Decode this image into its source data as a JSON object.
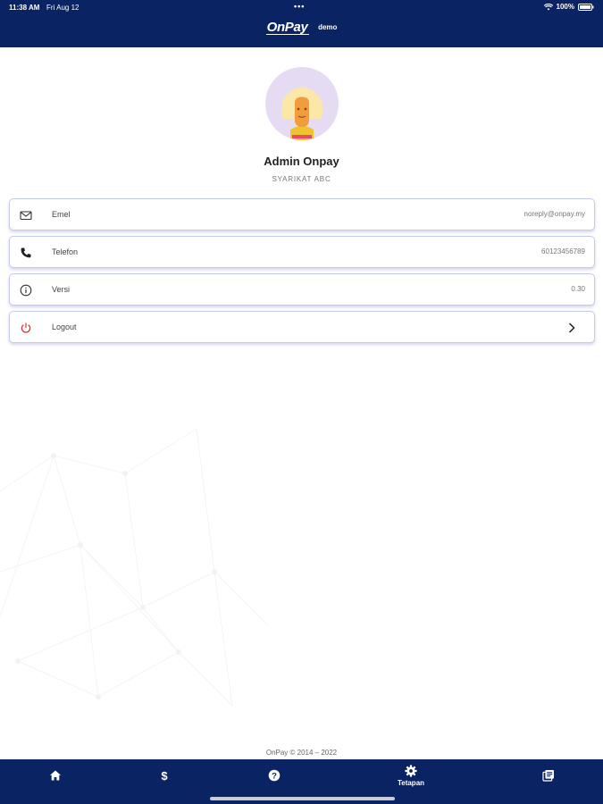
{
  "status_bar": {
    "time": "11:38 AM",
    "date": "Fri Aug 12",
    "dots": "•••",
    "battery": "100%"
  },
  "header": {
    "logo": "OnPay",
    "env_tag": "demo"
  },
  "profile": {
    "name": "Admin Onpay",
    "company": "SYARIKAT ABC"
  },
  "info_rows": [
    {
      "icon": "mail-icon",
      "label": "Emel",
      "value": "noreply@onpay.my"
    },
    {
      "icon": "phone-icon",
      "label": "Telefon",
      "value": "60123456789"
    },
    {
      "icon": "info-icon",
      "label": "Versi",
      "value": "0.30"
    },
    {
      "icon": "power-icon",
      "label": "Logout",
      "value": ""
    }
  ],
  "footer": {
    "copyright": "OnPay © 2014 – 2022"
  },
  "bottom_nav": {
    "items": [
      {
        "icon": "home-icon",
        "label": ""
      },
      {
        "icon": "dollar-icon",
        "label": ""
      },
      {
        "icon": "help-icon",
        "label": ""
      },
      {
        "icon": "gear-icon",
        "label": "Tetapan"
      },
      {
        "icon": "library-icon",
        "label": ""
      }
    ],
    "active": "Tetapan"
  },
  "colors": {
    "brand_navy": "#0a2463",
    "card_border": "#c6c9ef",
    "logout_icon": "#d32f2f",
    "avatar_bg": "#e5dcf4"
  }
}
